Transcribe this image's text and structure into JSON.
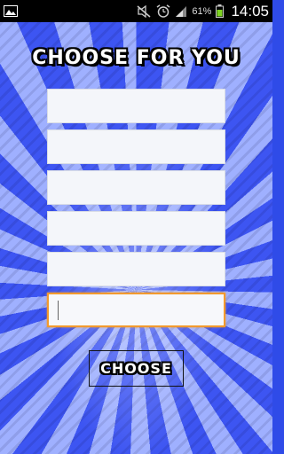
{
  "status_bar": {
    "battery_percent": "61%",
    "time": "14:05",
    "icons": [
      "image-notification-icon",
      "mute-icon",
      "alarm-icon",
      "signal-icon",
      "battery-icon"
    ]
  },
  "app": {
    "title": "CHOOSE FOR YOU",
    "fields": [
      {
        "value": "",
        "placeholder": ""
      },
      {
        "value": "",
        "placeholder": ""
      },
      {
        "value": "",
        "placeholder": ""
      },
      {
        "value": "",
        "placeholder": ""
      },
      {
        "value": "",
        "placeholder": ""
      },
      {
        "value": "",
        "placeholder": "",
        "focused": true
      }
    ],
    "choose_label": "CHOOSE"
  },
  "colors": {
    "background": "#2f4be8",
    "focus_border": "#f29a2e",
    "field_bg": "#f4f6fa"
  }
}
